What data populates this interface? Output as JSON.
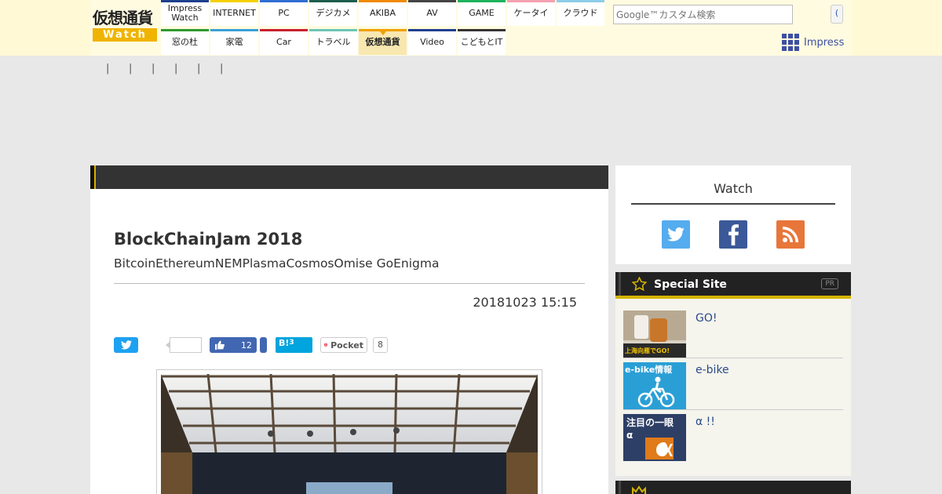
{
  "logo": {
    "jp": "仮想通貨",
    "watch": "Watch"
  },
  "nav": {
    "top": [
      {
        "label": "Impress Watch",
        "color": "#1f3f8f"
      },
      {
        "label": "INTERNET",
        "color": "#f5d000"
      },
      {
        "label": "PC",
        "color": "#2e6fd3"
      },
      {
        "label": "デジカメ",
        "color": "#1d5d4d"
      },
      {
        "label": "AKIBA",
        "color": "#f08a00"
      },
      {
        "label": "AV",
        "color": "#444444"
      },
      {
        "label": "GAME",
        "color": "#1db35c"
      },
      {
        "label": "ケータイ",
        "color": "#f5a0b0"
      },
      {
        "label": "クラウド",
        "color": "#8ccde8"
      }
    ],
    "bottom": [
      {
        "label": "窓の杜",
        "color": "#2e9a2e"
      },
      {
        "label": "家電",
        "color": "#3aa0d8"
      },
      {
        "label": "Car",
        "color": "#c8202e"
      },
      {
        "label": "トラベル",
        "color": "#6cc7b3"
      },
      {
        "label": "仮想通貨",
        "color": "#f0a000",
        "active": true
      },
      {
        "label": "Video",
        "color": "#1f3f8f"
      },
      {
        "label": "こどもとIT",
        "color": "#333333"
      }
    ]
  },
  "search": {
    "placeholder": "Google™カスタム検索",
    "button": "("
  },
  "impress_link": "Impress",
  "subnav_pipes": [
    "|",
    "|",
    "|",
    "|",
    "|",
    "|"
  ],
  "article": {
    "title": "BlockChainJam 2018",
    "subtitle": "BitcoinEthereumNEMPlasmaCosmosOmise GoEnigma",
    "date": "20181023 15:15"
  },
  "share": {
    "twitter_count": "",
    "facebook_count": "12",
    "hatena_label": "B!",
    "hatena_count": "3",
    "pocket_label": "Pocket",
    "pocket_count": "8"
  },
  "sidebar": {
    "watch_title": "Watch",
    "special_title": "Special Site",
    "pr_badge": "PR",
    "special_items": [
      {
        "label": "GO!",
        "thumb_text": "上海向雁でGO!"
      },
      {
        "label": "e-bike",
        "thumb_text": "e-bike情報"
      },
      {
        "label": "α !!",
        "thumb_text": "注目の一眼α"
      }
    ]
  },
  "colors": {
    "accent_yellow": "#f0b400",
    "header_bg": "#fffbe0",
    "dark_bar": "#333333",
    "link_blue": "#2a4a8a"
  }
}
